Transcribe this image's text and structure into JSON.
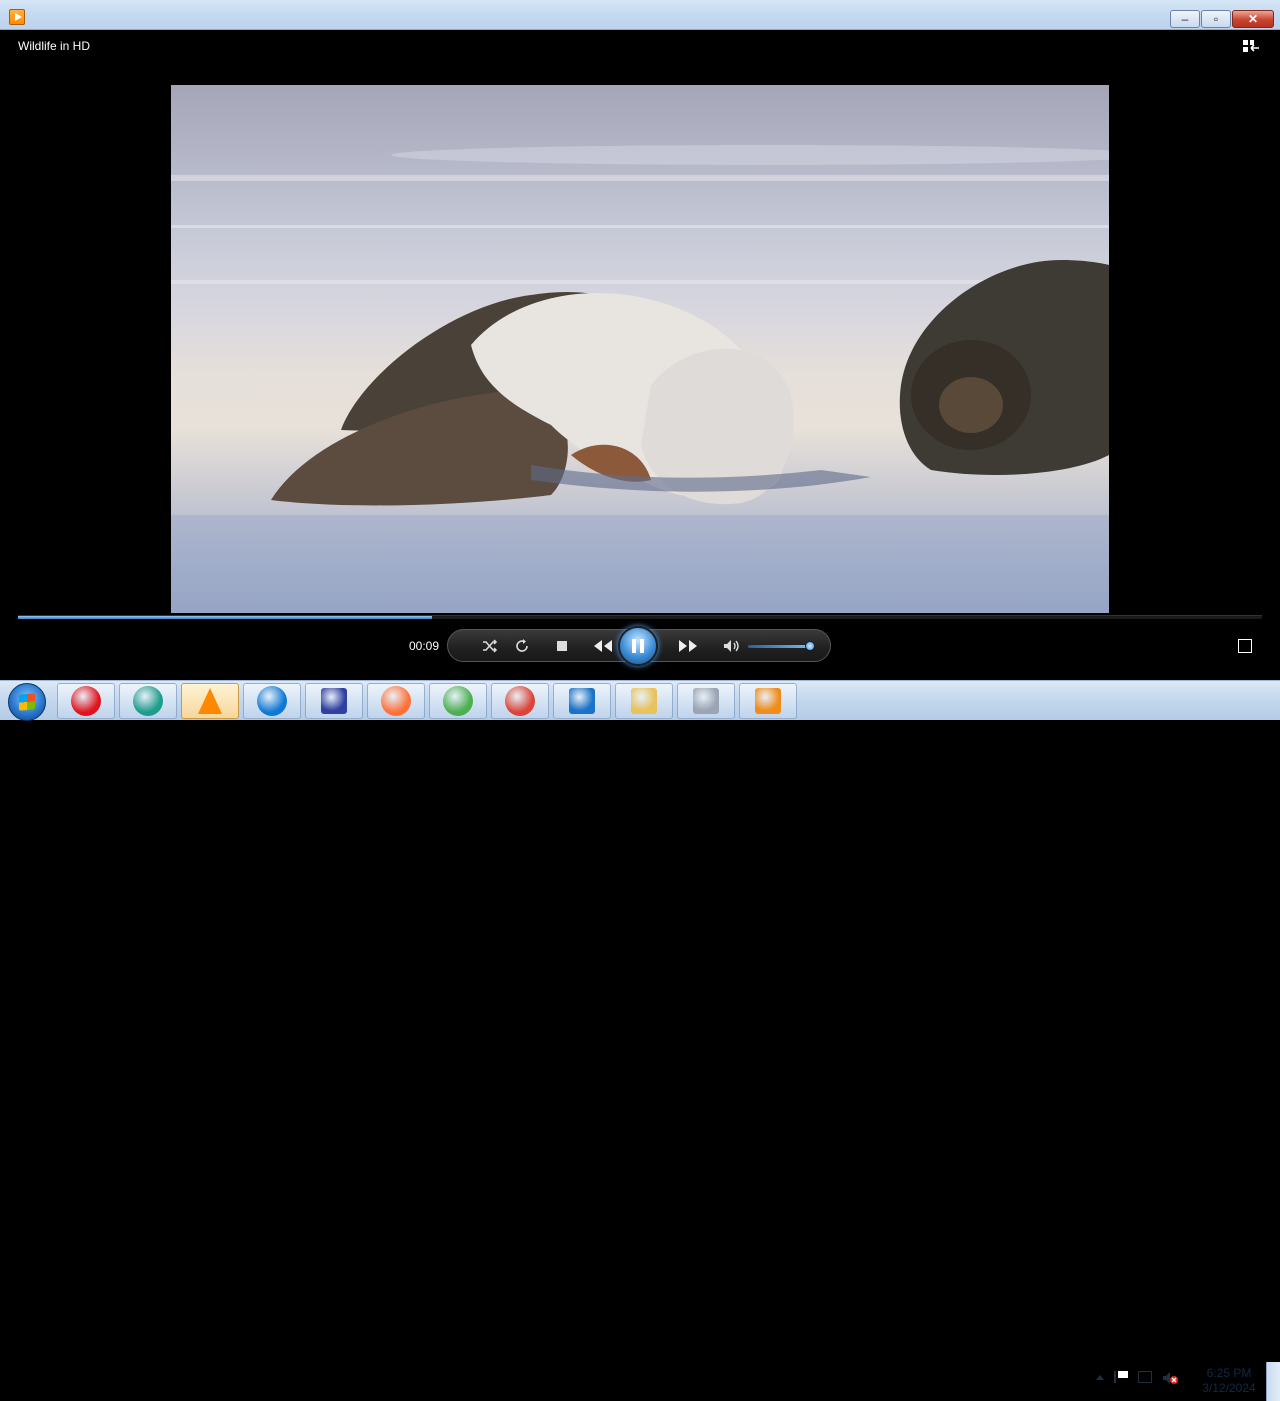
{
  "window": {
    "title": "Wildlife in HD",
    "buttons": {
      "minimize": "–",
      "maximize": "▫",
      "close": "✕"
    }
  },
  "player": {
    "elapsed": "00:09",
    "progress_fraction": 0.333,
    "volume_fraction": 0.9,
    "state": "playing"
  },
  "taskbar": {
    "apps": [
      {
        "name": "opera-icon",
        "color": "#e0141e"
      },
      {
        "name": "ocean-app-icon",
        "color": "#1e9c8c"
      },
      {
        "name": "vlc-icon",
        "color": "#ff8800"
      },
      {
        "name": "edge-icon",
        "color": "#0f78d4"
      },
      {
        "name": "save-disk-icon",
        "color": "#3040a0"
      },
      {
        "name": "firefox-icon",
        "color": "#ff7139"
      },
      {
        "name": "windows-logo-icon",
        "color": "#4caf50"
      },
      {
        "name": "chrome-icon",
        "color": "#db4437"
      },
      {
        "name": "vscode-icon",
        "color": "#1a73c8"
      },
      {
        "name": "file-explorer-icon",
        "color": "#e8c25a"
      },
      {
        "name": "archive-icon",
        "color": "#9aa4b2"
      },
      {
        "name": "media-player-icon",
        "color": "#f08c1a"
      }
    ],
    "clock_time": "6:25 PM",
    "clock_date": "3/12/2024"
  }
}
